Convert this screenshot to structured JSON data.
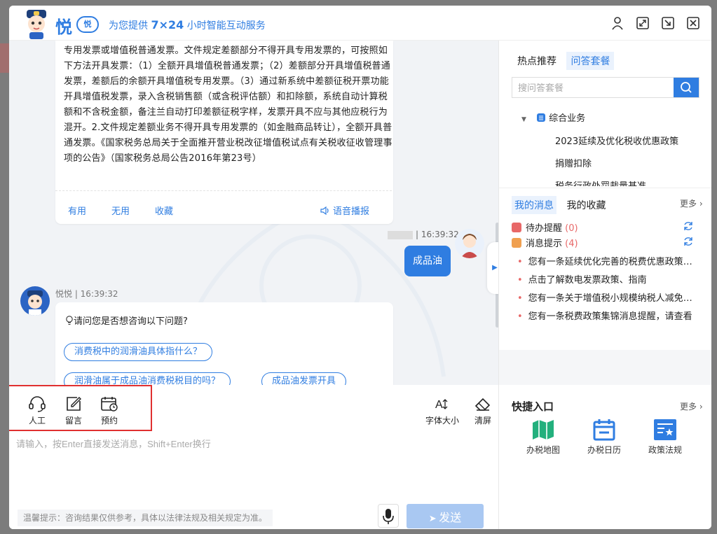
{
  "header": {
    "brand": "悦",
    "badge": "悦",
    "tagline_pre": "为您提供",
    "tagline_bold": "7×24",
    "tagline_post": "小时智能互动服务"
  },
  "chat": {
    "answer_text": "专用发票或增值税普通发票。文件规定差额部分不得开具专用发票的，可按照如下方法开具发票：（1）全额开具增值税普通发票；（2）差额部分开具增值税普通发票，差额后的余额开具增值税专用发票。（3）通过新系统中差额征税开票功能开具增值税发票，录入含税销售额（或含税评估额）和扣除额，系统自动计算税额和不含税金额，备注兰自动打印差额征税字样，发票开具不应与其他应税行为混开。2.文件规定差额业务不得开具专用发票的（如金融商品转让），全额开具普通发票。《国家税务总局关于全面推开营业税改征增值税试点有关税收征收管理事项的公告》（国家税务总局公告2016年第23号）",
    "actions": {
      "useful": "有用",
      "useless": "无用",
      "collect": "收藏",
      "voice": "语音播报"
    },
    "user_time": "| 16:39:32",
    "user_message": "成品油",
    "bot_meta": "悦悦 | 16:39:32",
    "suggest_question": "请问您是否想咨询以下问题?",
    "suggestions": [
      "消费税中的润滑油具体指什么？",
      "润滑油属于成品油消费税税目的吗？",
      "成品油发票开具"
    ]
  },
  "toolbar": {
    "human": "人工",
    "message": "留言",
    "appointment": "预约",
    "font_size": "字体大小",
    "clear": "清屏"
  },
  "input": {
    "placeholder": "请输入，按Enter直接发送消息，Shift+Enter换行",
    "tip": "温馨提示：咨询结果仅供参考，具体以法律法规及相关规定为准。",
    "send": "发送"
  },
  "right": {
    "tabs": [
      "热点推荐",
      "问答套餐"
    ],
    "search_placeholder": "搜问答套餐",
    "tree_root": "综合业务",
    "tree_children": [
      "2023延续及优化税收优惠政策",
      "捐赠扣除",
      "税务行政处罚裁量基准"
    ],
    "msg_tabs": [
      "我的消息",
      "我的收藏"
    ],
    "more": "更多",
    "todo_label": "待办提醒",
    "todo_count": "(0)",
    "notice_label": "消息提示",
    "notice_count": "(4)",
    "news": [
      "您有一条延续优化完善的税费优惠政策提醒",
      "点击了解数电发票政策、指南",
      "您有一条关于增值税小规模纳税人减免增值税的提醒",
      "您有一条税费政策集锦消息提醒，请查看"
    ],
    "quick_title": "快捷入口",
    "quick_more": "更多",
    "quick_items": [
      "办税地图",
      "办税日历",
      "政策法规"
    ]
  },
  "colors": {
    "accent": "#2f7de1",
    "highlight": "#e03030",
    "count": "#e86868"
  }
}
